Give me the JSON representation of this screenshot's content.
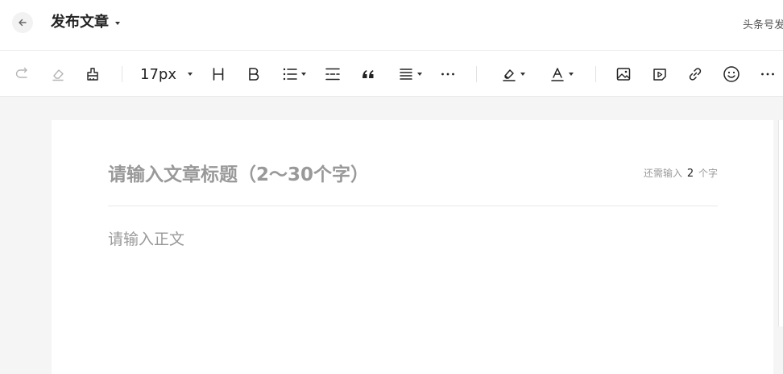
{
  "header": {
    "title": "发布文章",
    "account_link": "头条号发"
  },
  "toolbar": {
    "font_size": "17px",
    "tools": [
      {
        "name": "redo",
        "icon": "redo-icon"
      },
      {
        "name": "clear-format",
        "icon": "eraser-icon"
      },
      {
        "name": "format-painter",
        "icon": "format-painter-icon"
      },
      {
        "name": "font-size",
        "label": "17px"
      },
      {
        "name": "heading",
        "icon": "heading-icon"
      },
      {
        "name": "bold",
        "icon": "bold-icon"
      },
      {
        "name": "list",
        "icon": "list-icon"
      },
      {
        "name": "divider",
        "icon": "divider-line-icon"
      },
      {
        "name": "quote",
        "icon": "quote-icon"
      },
      {
        "name": "align",
        "icon": "align-icon"
      },
      {
        "name": "more-format",
        "icon": "more-icon"
      },
      {
        "name": "highlight",
        "icon": "highlighter-icon"
      },
      {
        "name": "font-color",
        "icon": "font-color-icon"
      },
      {
        "name": "image",
        "icon": "image-icon"
      },
      {
        "name": "video",
        "icon": "video-icon"
      },
      {
        "name": "link",
        "icon": "link-icon"
      },
      {
        "name": "emoji",
        "icon": "emoji-icon"
      },
      {
        "name": "more-insert",
        "icon": "more-icon"
      }
    ]
  },
  "editor": {
    "title_placeholder": "请输入文章标题（2～30个字）",
    "count_prefix": "还需输入",
    "count_value": "2",
    "count_suffix": "个字",
    "body_placeholder": "请输入正文"
  },
  "colors": {
    "placeholder": "#999999",
    "background": "#f5f5f5",
    "paper": "#ffffff"
  }
}
